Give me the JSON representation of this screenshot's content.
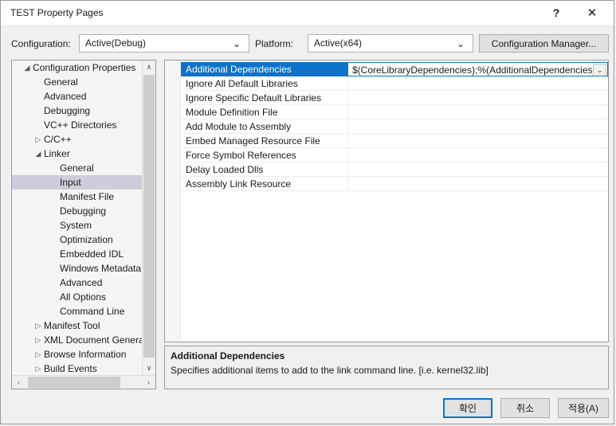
{
  "window": {
    "title": "TEST Property Pages",
    "help_icon": "question-mark-icon",
    "help_label": "?",
    "close_label": "✕"
  },
  "toolbar": {
    "configuration_label": "Configuration:",
    "configuration_value": "Active(Debug)",
    "platform_label": "Platform:",
    "platform_value": "Active(x64)",
    "configuration_manager_label": "Configuration Manager...",
    "dropdown_arrow": "⌄"
  },
  "tree": {
    "items": [
      {
        "label": "Configuration Properties",
        "indent": 0,
        "twisty": "◢",
        "selected": false
      },
      {
        "label": "General",
        "indent": 1,
        "twisty": "",
        "selected": false
      },
      {
        "label": "Advanced",
        "indent": 1,
        "twisty": "",
        "selected": false
      },
      {
        "label": "Debugging",
        "indent": 1,
        "twisty": "",
        "selected": false
      },
      {
        "label": "VC++ Directories",
        "indent": 1,
        "twisty": "",
        "selected": false
      },
      {
        "label": "C/C++",
        "indent": 1,
        "twisty": "▷",
        "selected": false
      },
      {
        "label": "Linker",
        "indent": 1,
        "twisty": "◢",
        "selected": false
      },
      {
        "label": "General",
        "indent": 2,
        "twisty": "",
        "selected": false
      },
      {
        "label": "Input",
        "indent": 2,
        "twisty": "",
        "selected": true
      },
      {
        "label": "Manifest File",
        "indent": 2,
        "twisty": "",
        "selected": false
      },
      {
        "label": "Debugging",
        "indent": 2,
        "twisty": "",
        "selected": false
      },
      {
        "label": "System",
        "indent": 2,
        "twisty": "",
        "selected": false
      },
      {
        "label": "Optimization",
        "indent": 2,
        "twisty": "",
        "selected": false
      },
      {
        "label": "Embedded IDL",
        "indent": 2,
        "twisty": "",
        "selected": false
      },
      {
        "label": "Windows Metadata",
        "indent": 2,
        "twisty": "",
        "selected": false
      },
      {
        "label": "Advanced",
        "indent": 2,
        "twisty": "",
        "selected": false
      },
      {
        "label": "All Options",
        "indent": 2,
        "twisty": "",
        "selected": false
      },
      {
        "label": "Command Line",
        "indent": 2,
        "twisty": "",
        "selected": false
      },
      {
        "label": "Manifest Tool",
        "indent": 1,
        "twisty": "▷",
        "selected": false
      },
      {
        "label": "XML Document Generator",
        "indent": 1,
        "twisty": "▷",
        "selected": false
      },
      {
        "label": "Browse Information",
        "indent": 1,
        "twisty": "▷",
        "selected": false
      },
      {
        "label": "Build Events",
        "indent": 1,
        "twisty": "▷",
        "selected": false
      }
    ],
    "scroll_up_arrow": "∧",
    "scroll_down_arrow": "∨",
    "scroll_left_arrow": "‹",
    "scroll_right_arrow": "›"
  },
  "grid": {
    "rows": [
      {
        "name": "Additional Dependencies",
        "value": "$(CoreLibraryDependencies);%(AdditionalDependencies)",
        "selected": true
      },
      {
        "name": "Ignore All Default Libraries",
        "value": "",
        "selected": false
      },
      {
        "name": "Ignore Specific Default Libraries",
        "value": "",
        "selected": false
      },
      {
        "name": "Module Definition File",
        "value": "",
        "selected": false
      },
      {
        "name": "Add Module to Assembly",
        "value": "",
        "selected": false
      },
      {
        "name": "Embed Managed Resource File",
        "value": "",
        "selected": false
      },
      {
        "name": "Force Symbol References",
        "value": "",
        "selected": false
      },
      {
        "name": "Delay Loaded Dlls",
        "value": "",
        "selected": false
      },
      {
        "name": "Assembly Link Resource",
        "value": "",
        "selected": false
      }
    ],
    "value_dropdown_arrow": "⌄"
  },
  "description": {
    "title": "Additional Dependencies",
    "text": "Specifies additional items to add to the link command line. [i.e. kernel32.lib]"
  },
  "footer": {
    "ok_label": "확인",
    "cancel_label": "취소",
    "apply_label": "적용(A)"
  },
  "colors": {
    "selection_blue": "#0d72c8",
    "tree_selection": "#cdced9",
    "dialog_background": "#f0f0f0"
  }
}
